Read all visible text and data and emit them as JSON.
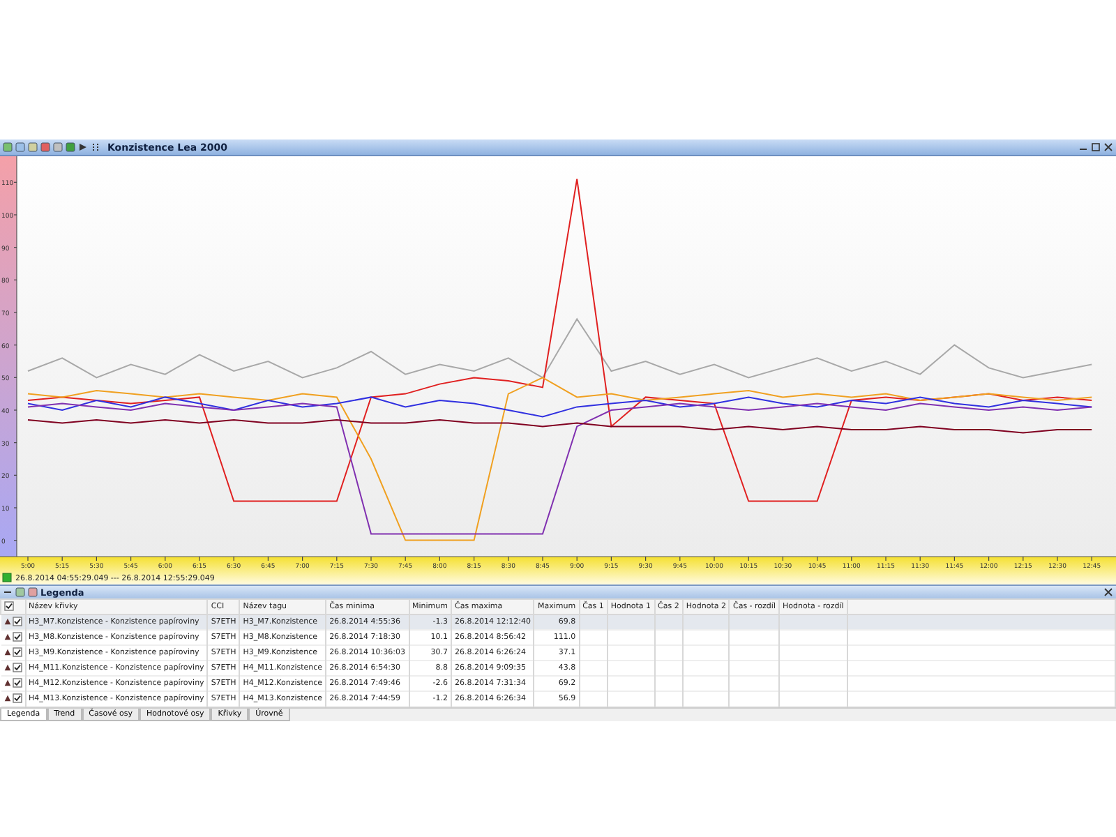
{
  "window": {
    "title": "Konzistence Lea 2000"
  },
  "chart": {
    "chart_data": {
      "type": "line",
      "categories": [
        "5:00",
        "5:15",
        "5:30",
        "5:45",
        "6:00",
        "6:15",
        "6:30",
        "6:45",
        "7:00",
        "7:15",
        "7:30",
        "7:45",
        "8:00",
        "8:15",
        "8:30",
        "8:45",
        "9:00",
        "9:15",
        "9:30",
        "9:45",
        "10:00",
        "10:15",
        "10:30",
        "10:45",
        "11:00",
        "11:15",
        "11:30",
        "11:45",
        "12:00",
        "12:15",
        "12:30",
        "12:45"
      ],
      "ylim": [
        -5,
        118
      ],
      "yticks": [
        0,
        10,
        20,
        30,
        40,
        50,
        60,
        70,
        80,
        90,
        100,
        110
      ],
      "series": [
        {
          "color": "#a8a8a8",
          "values": [
            52,
            56,
            50,
            54,
            51,
            57,
            52,
            55,
            50,
            53,
            58,
            51,
            54,
            52,
            56,
            50,
            68,
            52,
            55,
            51,
            54,
            50,
            53,
            56,
            52,
            55,
            51,
            60,
            53,
            50,
            52,
            54
          ]
        },
        {
          "color": "#e02020",
          "values": [
            43,
            44,
            43,
            42,
            43,
            44,
            12,
            12,
            12,
            12,
            44,
            45,
            48,
            50,
            49,
            47,
            111,
            35,
            44,
            43,
            42,
            12,
            12,
            12,
            43,
            44,
            43,
            44,
            45,
            43,
            44,
            43
          ]
        },
        {
          "color": "#f0a020",
          "values": [
            45,
            44,
            46,
            45,
            44,
            45,
            44,
            43,
            45,
            44,
            25,
            0,
            0,
            0,
            45,
            50,
            44,
            45,
            43,
            44,
            45,
            46,
            44,
            45,
            44,
            45,
            43,
            44,
            45,
            44,
            43,
            44
          ]
        },
        {
          "color": "#3030e0",
          "values": [
            42,
            40,
            43,
            41,
            44,
            42,
            40,
            43,
            41,
            42,
            44,
            41,
            43,
            42,
            40,
            38,
            41,
            42,
            43,
            41,
            42,
            44,
            42,
            41,
            43,
            42,
            44,
            42,
            41,
            43,
            42,
            41
          ]
        },
        {
          "color": "#8030b0",
          "values": [
            41,
            42,
            41,
            40,
            42,
            41,
            40,
            41,
            42,
            41,
            2,
            2,
            2,
            2,
            2,
            2,
            35,
            40,
            41,
            42,
            41,
            40,
            41,
            42,
            41,
            40,
            42,
            41,
            40,
            41,
            40,
            41
          ]
        },
        {
          "color": "#800020",
          "values": [
            37,
            36,
            37,
            36,
            37,
            36,
            37,
            36,
            36,
            37,
            36,
            36,
            37,
            36,
            36,
            35,
            36,
            35,
            35,
            35,
            34,
            35,
            34,
            35,
            34,
            34,
            35,
            34,
            34,
            33,
            34,
            34
          ]
        }
      ]
    }
  },
  "time_range": "26.8.2014 04:55:29.049 --- 26.8.2014 12:55:29.049",
  "legend": {
    "title": "Legenda",
    "all_checked": true,
    "columns": [
      "Název křivky",
      "CCI",
      "Název tagu",
      "Čas minima",
      "Minimum",
      "Čas maxima",
      "Maximum",
      "Čas 1",
      "Hodnota 1",
      "Čas 2",
      "Hodnota 2",
      "Čas - rozdíl",
      "Hodnota - rozdíl"
    ],
    "rows": [
      {
        "selected": true,
        "checked": true,
        "cells": [
          "H3_M7.Konzistence - Konzistence papíroviny",
          "S7ETH",
          "H3_M7.Konzistence",
          "26.8.2014 4:55:36",
          "-1.3",
          "26.8.2014 12:12:40",
          "69.8"
        ]
      },
      {
        "selected": false,
        "checked": true,
        "cells": [
          "H3_M8.Konzistence - Konzistence papíroviny",
          "S7ETH",
          "H3_M8.Konzistence",
          "26.8.2014 7:18:30",
          "10.1",
          "26.8.2014 8:56:42",
          "111.0"
        ]
      },
      {
        "selected": false,
        "checked": true,
        "cells": [
          "H3_M9.Konzistence - Konzistence papíroviny",
          "S7ETH",
          "H3_M9.Konzistence",
          "26.8.2014 10:36:03",
          "30.7",
          "26.8.2014 6:26:24",
          "37.1"
        ]
      },
      {
        "selected": false,
        "checked": true,
        "cells": [
          "H4_M11.Konzistence - Konzistence papíroviny",
          "S7ETH",
          "H4_M11.Konzistence",
          "26.8.2014 6:54:30",
          "8.8",
          "26.8.2014 9:09:35",
          "43.8"
        ]
      },
      {
        "selected": false,
        "checked": true,
        "cells": [
          "H4_M12.Konzistence - Konzistence papíroviny",
          "S7ETH",
          "H4_M12.Konzistence",
          "26.8.2014 7:49:46",
          "-2.6",
          "26.8.2014 7:31:34",
          "69.2"
        ]
      },
      {
        "selected": false,
        "checked": true,
        "cells": [
          "H4_M13.Konzistence - Konzistence papíroviny",
          "S7ETH",
          "H4_M13.Konzistence",
          "26.8.2014 7:44:59",
          "-1.2",
          "26.8.2014 6:26:34",
          "56.9"
        ]
      }
    ]
  },
  "tabs": [
    {
      "label": "Legenda",
      "selected": true
    },
    {
      "label": "Trend",
      "selected": false
    },
    {
      "label": "Časové osy",
      "selected": false
    },
    {
      "label": "Hodnotové osy",
      "selected": false
    },
    {
      "label": "Křivky",
      "selected": false
    },
    {
      "label": "Úrovně",
      "selected": false
    }
  ]
}
